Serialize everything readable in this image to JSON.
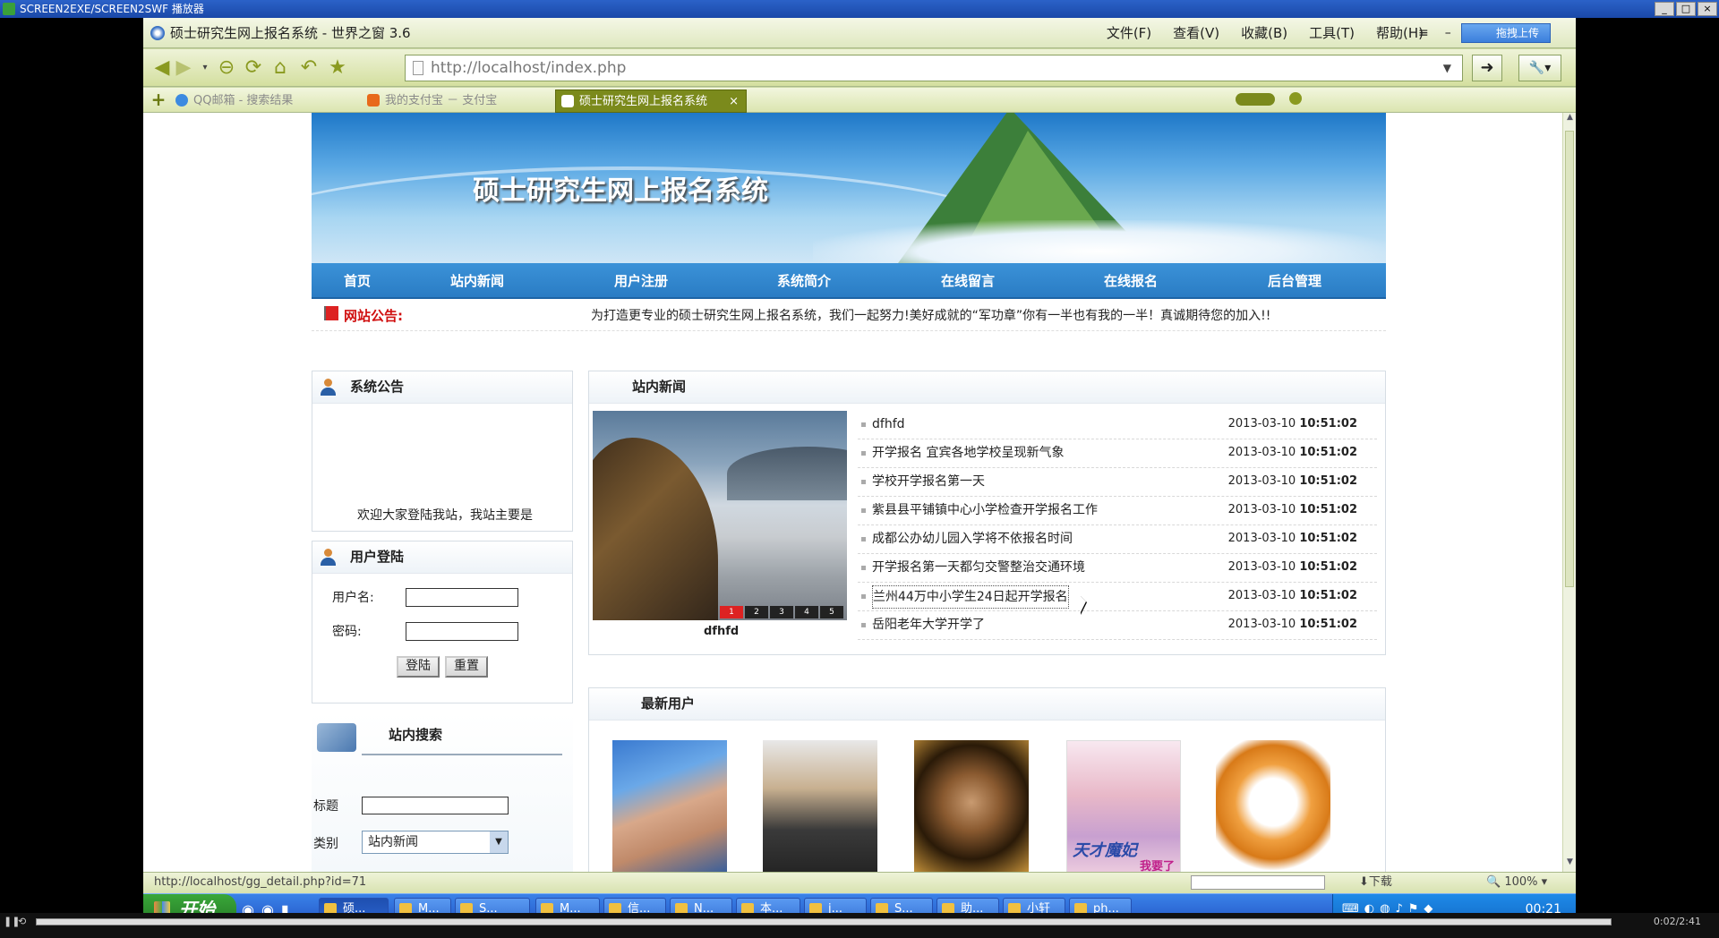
{
  "outer": {
    "title": "SCREEN2EXE/SCREEN2SWF 播放器"
  },
  "browser": {
    "title": "硕士研究生网上报名系统 - 世界之窗 3.6",
    "menu": [
      "文件(F)",
      "查看(V)",
      "收藏(B)",
      "工具(T)",
      "帮助(H)"
    ],
    "upload_label": "拖拽上传",
    "address": "http://localhost/index.php",
    "tabs": [
      {
        "label": "QQ邮箱 - 搜索结果"
      },
      {
        "label": "我的支付宝 － 支付宝"
      },
      {
        "label": "硕士研究生网上报名系统"
      }
    ],
    "status_url": "http://localhost/gg_detail.php?id=71",
    "download_label": "下载",
    "zoom": "100%"
  },
  "site": {
    "title": "硕士研究生网上报名系统",
    "nav": [
      "首页",
      "站内新闻",
      "用户注册",
      "系统简介",
      "在线留言",
      "在线报名",
      "后台管理"
    ],
    "notice_label": "网站公告:",
    "notice_text": "为打造更专业的硕士研究生网上报名系统，我们一起努力!美好成就的“军功章”你有一半也有我的一半！真诚期待您的加入!!"
  },
  "announce": {
    "heading": "系统公告",
    "text": "欢迎大家登陆我站，我站主要是"
  },
  "login": {
    "heading": "用户登陆",
    "username_label": "用户名:",
    "password_label": "密码:",
    "login_button": "登陆",
    "reset_button": "重置"
  },
  "search": {
    "heading": "站内搜索",
    "title_label": "标题",
    "category_label": "类别",
    "category_value": "站内新闻"
  },
  "news": {
    "heading": "站内新闻",
    "slide_caption": "dfhfd",
    "slide_numbers": [
      "1",
      "2",
      "3",
      "4",
      "5"
    ],
    "items": [
      {
        "title": "dfhfd",
        "date": "2013-03-10",
        "time": "10:51:02"
      },
      {
        "title": "开学报名 宜宾各地学校呈现新气象",
        "date": "2013-03-10",
        "time": "10:51:02"
      },
      {
        "title": "学校开学报名第一天",
        "date": "2013-03-10",
        "time": "10:51:02"
      },
      {
        "title": "紫县县平铺镇中心小学检查开学报名工作",
        "date": "2013-03-10",
        "time": "10:51:02"
      },
      {
        "title": "成都公办幼儿园入学将不依报名时间",
        "date": "2013-03-10",
        "time": "10:51:02"
      },
      {
        "title": "开学报名第一天都匀交警整治交通环境",
        "date": "2013-03-10",
        "time": "10:51:02"
      },
      {
        "title": "兰州44万中小学生24日起开学报名",
        "date": "2013-03-10",
        "time": "10:51:02"
      },
      {
        "title": "岳阳老年大学开学了",
        "date": "2013-03-10",
        "time": "10:51:02"
      }
    ]
  },
  "users": {
    "heading": "最新用户",
    "avatar4_text1": "天才魔妃",
    "avatar4_text2": "我要了"
  },
  "taskbar": {
    "start_label": "开始",
    "tasks": [
      "硕...",
      "M...",
      "S...",
      "M...",
      "信...",
      "N...",
      "本...",
      "j...",
      "S...",
      "助...",
      "小轩",
      "ph..."
    ],
    "clock": "00:21"
  },
  "player": {
    "time": "0:02/2:41"
  }
}
